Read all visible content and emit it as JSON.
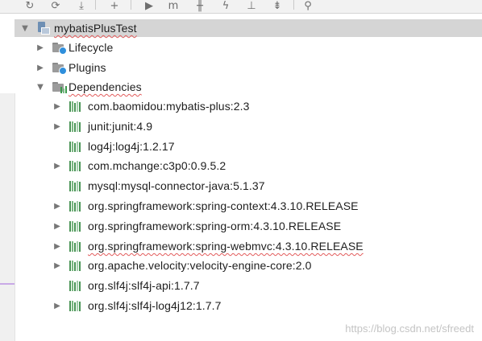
{
  "toolbar": {
    "buttons": [
      {
        "icon": "refresh-icon",
        "glyph": "↻"
      },
      {
        "icon": "generate-sources-icon",
        "glyph": "⟳"
      },
      {
        "icon": "download-icon",
        "glyph": "⤓"
      },
      {
        "icon": "add-icon",
        "glyph": "+"
      },
      {
        "icon": "run-icon",
        "glyph": "▶"
      },
      {
        "icon": "maven-goal-icon",
        "glyph": "m"
      },
      {
        "icon": "toggle-offline-icon",
        "glyph": "╫"
      },
      {
        "icon": "skip-tests-icon",
        "glyph": "ϟ"
      },
      {
        "icon": "show-dependencies-icon",
        "glyph": "⊥"
      },
      {
        "icon": "collapse-all-icon",
        "glyph": "⇟"
      },
      {
        "icon": "settings-wrench-icon",
        "glyph": "⚲"
      }
    ]
  },
  "tree": {
    "project": {
      "label": "mybatisPlusTest",
      "expanded": true
    },
    "groups": [
      {
        "label": "Lifecycle",
        "expanded": false,
        "icon": "lifecycle-folder-icon"
      },
      {
        "label": "Plugins",
        "expanded": false,
        "icon": "plugins-folder-icon"
      },
      {
        "label": "Dependencies",
        "expanded": true,
        "icon": "dependencies-folder-icon"
      }
    ],
    "dependencies": [
      {
        "label": "com.baomidou:mybatis-plus:2.3",
        "expandable": true,
        "squiggle": false
      },
      {
        "label": "junit:junit:4.9",
        "expandable": true,
        "squiggle": false
      },
      {
        "label": "log4j:log4j:1.2.17",
        "expandable": false,
        "squiggle": false
      },
      {
        "label": "com.mchange:c3p0:0.9.5.2",
        "expandable": true,
        "squiggle": false
      },
      {
        "label": "mysql:mysql-connector-java:5.1.37",
        "expandable": false,
        "squiggle": false
      },
      {
        "label": "org.springframework:spring-context:4.3.10.RELEASE",
        "expandable": true,
        "squiggle": false
      },
      {
        "label": "org.springframework:spring-orm:4.3.10.RELEASE",
        "expandable": true,
        "squiggle": false
      },
      {
        "label": "org.springframework:spring-webmvc:4.3.10.RELEASE",
        "expandable": true,
        "squiggle": true
      },
      {
        "label": "org.apache.velocity:velocity-engine-core:2.0",
        "expandable": true,
        "squiggle": false
      },
      {
        "label": "org.slf4j:slf4j-api:1.7.7",
        "expandable": false,
        "squiggle": false
      },
      {
        "label": "org.slf4j:slf4j-log4j12:1.7.7",
        "expandable": true,
        "squiggle": false
      }
    ]
  },
  "watermark": "https://blog.csdn.net/sfreedt"
}
